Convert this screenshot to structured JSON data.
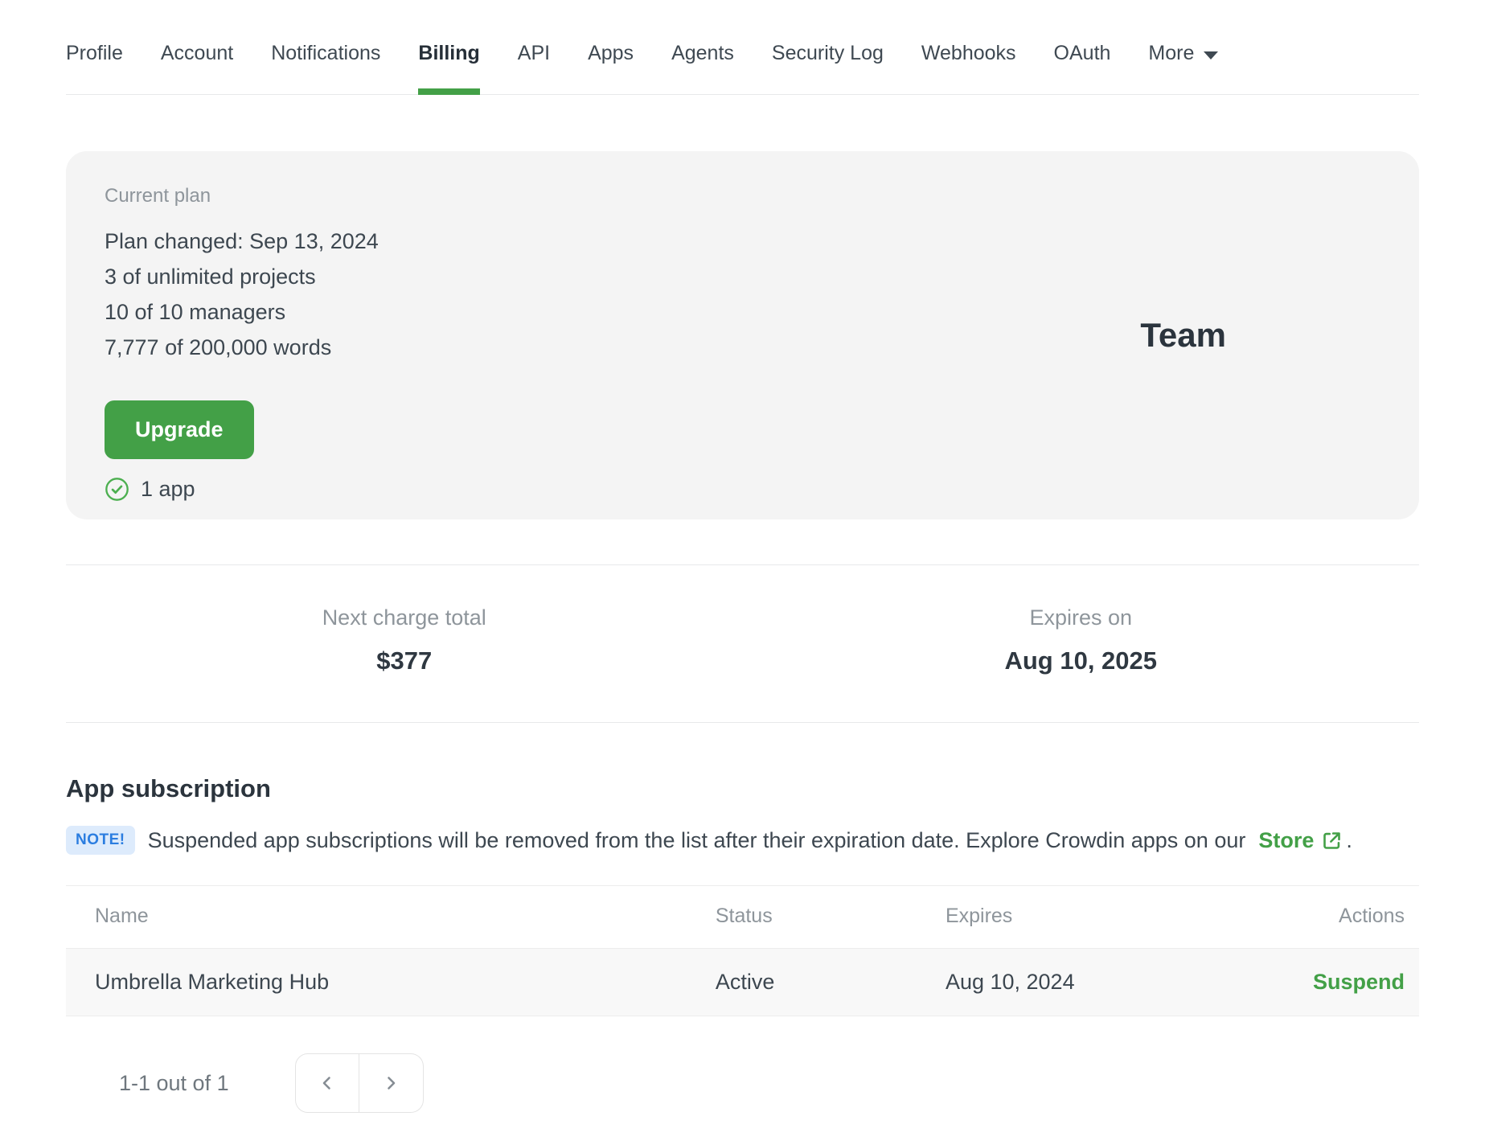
{
  "nav": {
    "tabs": [
      {
        "label": "Profile"
      },
      {
        "label": "Account"
      },
      {
        "label": "Notifications"
      },
      {
        "label": "Billing"
      },
      {
        "label": "API"
      },
      {
        "label": "Apps"
      },
      {
        "label": "Agents"
      },
      {
        "label": "Security Log"
      },
      {
        "label": "Webhooks"
      },
      {
        "label": "OAuth"
      },
      {
        "label": "More"
      }
    ],
    "active_tab": "Billing"
  },
  "plan_card": {
    "label": "Current plan",
    "details": [
      "Plan changed: Sep 13, 2024",
      "3 of unlimited projects",
      "10 of 10 managers",
      "7,777 of 200,000 words"
    ],
    "upgrade_label": "Upgrade",
    "apps_count": "1 app",
    "plan_name": "Team"
  },
  "billing_summary": {
    "next_charge_label": "Next charge total",
    "next_charge_value": "$377",
    "expires_label": "Expires on",
    "expires_value": "Aug 10, 2025"
  },
  "app_subscription": {
    "title": "App subscription",
    "note_badge": "NOTE!",
    "note_text": "Suspended app subscriptions will be removed from the list after their expiration date. Explore Crowdin apps on our",
    "store_link": "Store",
    "note_suffix": ".",
    "table": {
      "headers": [
        "Name",
        "Status",
        "Expires",
        "Actions"
      ],
      "rows": [
        {
          "name": "Umbrella Marketing Hub",
          "status": "Active",
          "expires": "Aug 10, 2024",
          "action": "Suspend"
        }
      ]
    },
    "pagination": {
      "label": "1-1 out of 1"
    }
  },
  "colors": {
    "accent_green": "#43a047",
    "note_blue": "#2b7de0",
    "card_background": "#f4f4f4"
  }
}
